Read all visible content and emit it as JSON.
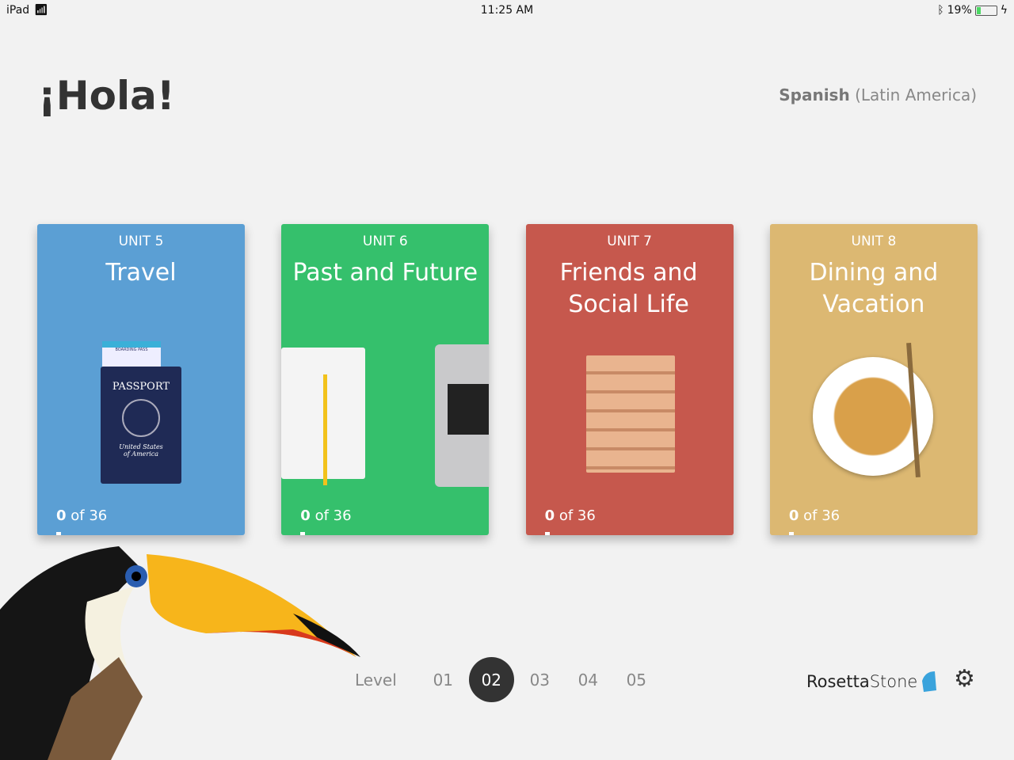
{
  "status_bar": {
    "device": "iPad",
    "time": "11:25 AM",
    "battery": "19%",
    "battery_level": 0.19
  },
  "greeting": "¡Hola!",
  "language": {
    "name": "Spanish",
    "variant": "(Latin America)"
  },
  "units": [
    {
      "unit": "UNIT 5",
      "title": "Travel",
      "done": "0",
      "of": "of 36",
      "color": "#5b9fd4",
      "art": "passport"
    },
    {
      "unit": "UNIT 6",
      "title": "Past and Future",
      "done": "0",
      "of": "of 36",
      "color": "#35c06c",
      "art": "notebook-laptop"
    },
    {
      "unit": "UNIT 7",
      "title": "Friends and Social Life",
      "done": "0",
      "of": "of 36",
      "color": "#c6584d",
      "art": "jenga"
    },
    {
      "unit": "UNIT 8",
      "title": "Dining and Vacation",
      "done": "0",
      "of": "of 36",
      "color": "#dcb872",
      "art": "noodles"
    }
  ],
  "passport": {
    "label": "PASSPORT",
    "sub": "United States of America",
    "boarding": "BOARDING PASS"
  },
  "levels": {
    "label": "Level",
    "items": [
      "01",
      "02",
      "03",
      "04",
      "05"
    ],
    "selected": "02"
  },
  "brand": {
    "name1": "Rosetta",
    "name2": "Stone"
  },
  "icons": {
    "settings": "gear-icon",
    "wifi": "wifi-icon",
    "bluetooth": "bluetooth-icon"
  }
}
